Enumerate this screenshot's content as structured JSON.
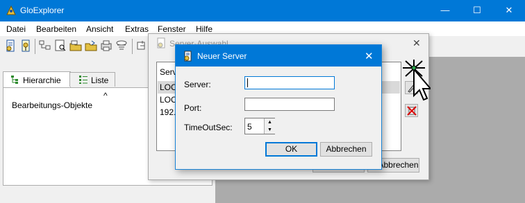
{
  "app": {
    "title": "GloExplorer"
  },
  "window_controls": {
    "minimize": "—",
    "maximize": "☐",
    "close": "✕"
  },
  "menu": [
    "Datei",
    "Bearbeiten",
    "Ansicht",
    "Extras",
    "Fenster",
    "Hilfe"
  ],
  "toolbar": {
    "icons": [
      "connect-icon",
      "disconnect-icon",
      "tree-icon",
      "preview-icon",
      "open-icon",
      "save-icon",
      "print-icon",
      "chart-icon",
      "filter-icon",
      "settings-icon"
    ]
  },
  "left_tabs": [
    {
      "label": "Hierarchie",
      "icon": "tree-icon",
      "active": true
    },
    {
      "label": "Liste",
      "icon": "list-icon",
      "active": false
    }
  ],
  "tree": {
    "root": "Bearbeitungs-Objekte",
    "collapse_glyph": "^"
  },
  "server_dialog": {
    "title": "Server-Auswahl",
    "list_header": "Server",
    "rows": [
      "LOCA",
      "LOCA",
      "192.1"
    ],
    "cancel_label": "Abbrechen",
    "close": "✕"
  },
  "new_server_dialog": {
    "title": "Neuer Server",
    "close": "✕",
    "fields": {
      "server_label": "Server:",
      "server_value": "",
      "port_label": "Port:",
      "port_value": "",
      "timeout_label": "TimeOutSec:",
      "timeout_value": "5"
    },
    "ok_label": "OK",
    "cancel_label": "Abbrechen"
  },
  "colors": {
    "accent": "#0078d7",
    "dialog_bg": "#f0f0f0",
    "workspace_bg": "#ababab"
  }
}
